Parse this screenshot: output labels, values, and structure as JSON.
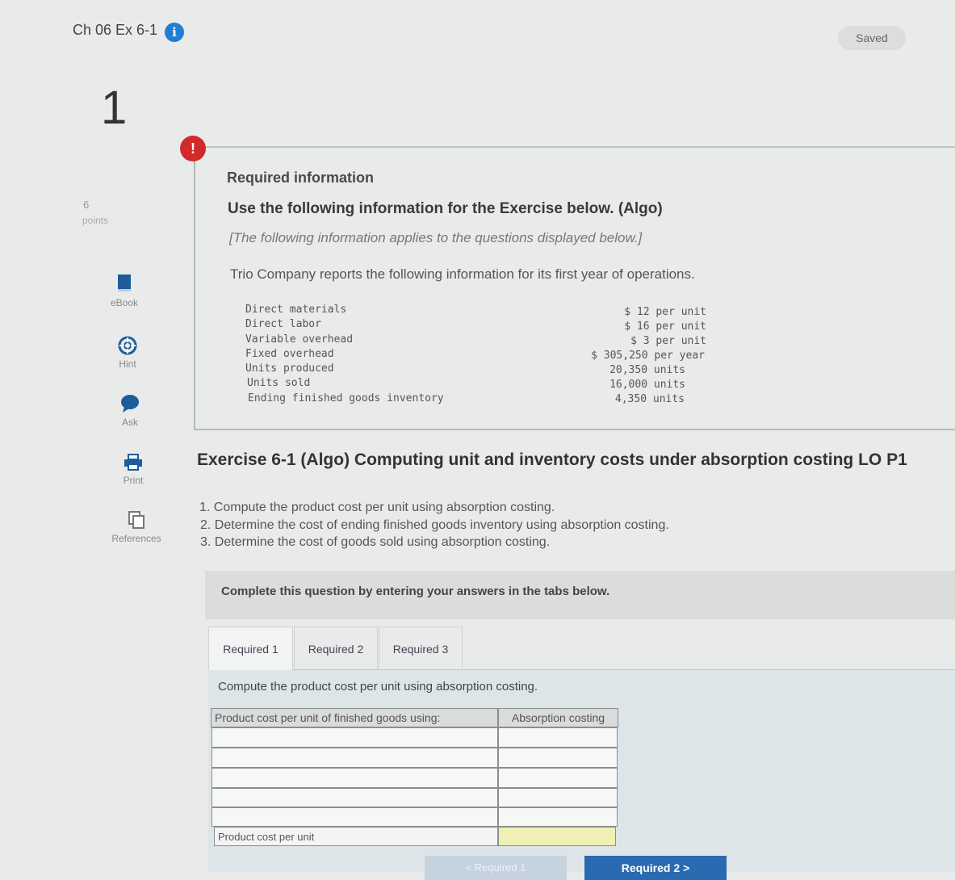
{
  "header": {
    "title": "Ch 06 Ex 6-1",
    "info_icon": "i",
    "saved_label": "Saved"
  },
  "question": {
    "number": "1",
    "points_value": "6",
    "points_label": "points"
  },
  "sidebar": {
    "tools": [
      {
        "label": "eBook",
        "icon": "book-icon"
      },
      {
        "label": "Hint",
        "icon": "lifebuoy-icon"
      },
      {
        "label": "Ask",
        "icon": "chat-bubble-icon"
      },
      {
        "label": "Print",
        "icon": "printer-icon"
      },
      {
        "label": "References",
        "icon": "copy-icon"
      }
    ]
  },
  "info": {
    "alert_icon": "!",
    "heading": "Required information",
    "subheading": "Use the following information for the Exercise below. (Algo)",
    "applies": "[The following information applies to the questions displayed below.]",
    "intro": "Trio Company reports the following information for its first year of operations.",
    "rows": [
      {
        "label": "Direct materials",
        "value": "$ 12 per unit"
      },
      {
        "label": "Direct labor",
        "value": "$ 16 per unit"
      },
      {
        "label": "Variable overhead",
        "value": "$ 3 per unit"
      },
      {
        "label": "Fixed overhead",
        "value": "$ 305,250 per year"
      },
      {
        "label": "Units produced",
        "value": "20,350 units"
      },
      {
        "label": "Units sold",
        "value": "16,000 units"
      },
      {
        "label": "Ending finished goods inventory",
        "value": "4,350 units"
      }
    ]
  },
  "exercise": {
    "title": "Exercise 6-1 (Algo) Computing unit and inventory costs under absorption costing LO P1",
    "requirements": [
      "1. Compute the product cost per unit using absorption costing.",
      "2. Determine the cost of ending finished goods inventory using absorption costing.",
      "3. Determine the cost of goods sold using absorption costing."
    ],
    "complete_text": "Complete this question by entering your answers in the tabs below."
  },
  "tabs": [
    {
      "label": "Required 1"
    },
    {
      "label": "Required 2"
    },
    {
      "label": "Required 3"
    }
  ],
  "panel": {
    "instruction": "Compute the product cost per unit using absorption costing.",
    "table_header_left": "Product cost per unit of finished goods using:",
    "table_header_right": "Absorption costing",
    "total_label": "Product cost per unit"
  },
  "nav": {
    "prev_label": "< Required 1",
    "next_label": "Required 2  >"
  },
  "colors": {
    "accent": "#1f7fd4",
    "alert": "#d22a2a",
    "total_cell": "#f0efb4",
    "next_button": "#2a6ab0"
  }
}
